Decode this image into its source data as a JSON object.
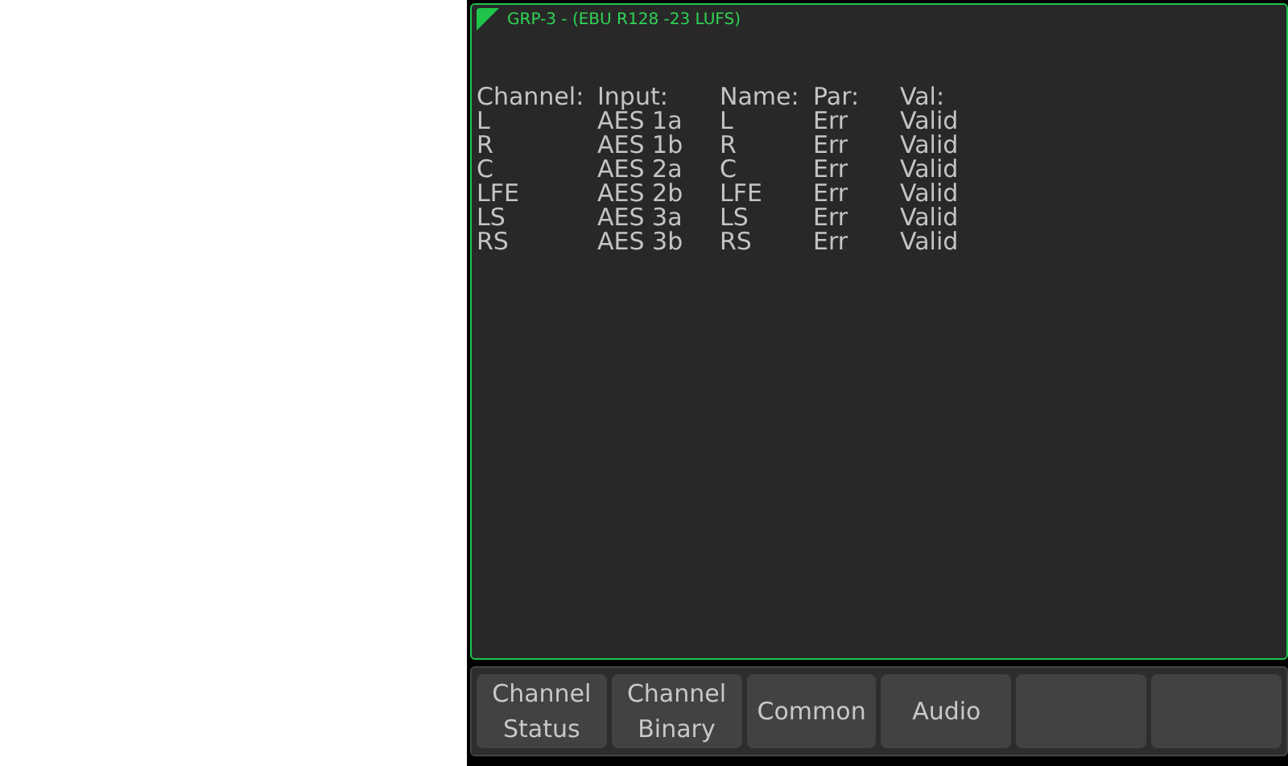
{
  "panel": {
    "title": "GRP-3 - (EBU R128 -23 LUFS)",
    "table": {
      "columns": [
        "Channel:",
        "Input:",
        "Name:",
        "Par:",
        "Val:"
      ],
      "rows": [
        [
          "L",
          "AES 1a",
          "L",
          "Err",
          "Valid"
        ],
        [
          "R",
          "AES 1b",
          "R",
          "Err",
          "Valid"
        ],
        [
          "C",
          "AES 2a",
          "C",
          "Err",
          "Valid"
        ],
        [
          "LFE",
          "AES 2b",
          "LFE",
          "Err",
          "Valid"
        ],
        [
          "LS",
          "AES 3a",
          "LS",
          "Err",
          "Valid"
        ],
        [
          "RS",
          "AES 3b",
          "RS",
          "Err",
          "Valid"
        ]
      ]
    }
  },
  "buttons": [
    {
      "kind": "text",
      "label": "Channel\nStatus"
    },
    {
      "kind": "text",
      "label": "Channel\nBinary"
    },
    {
      "kind": "text",
      "label": "Common"
    },
    {
      "kind": "text",
      "label": "Audio"
    },
    {
      "kind": "blank"
    },
    {
      "kind": "blank"
    }
  ]
}
